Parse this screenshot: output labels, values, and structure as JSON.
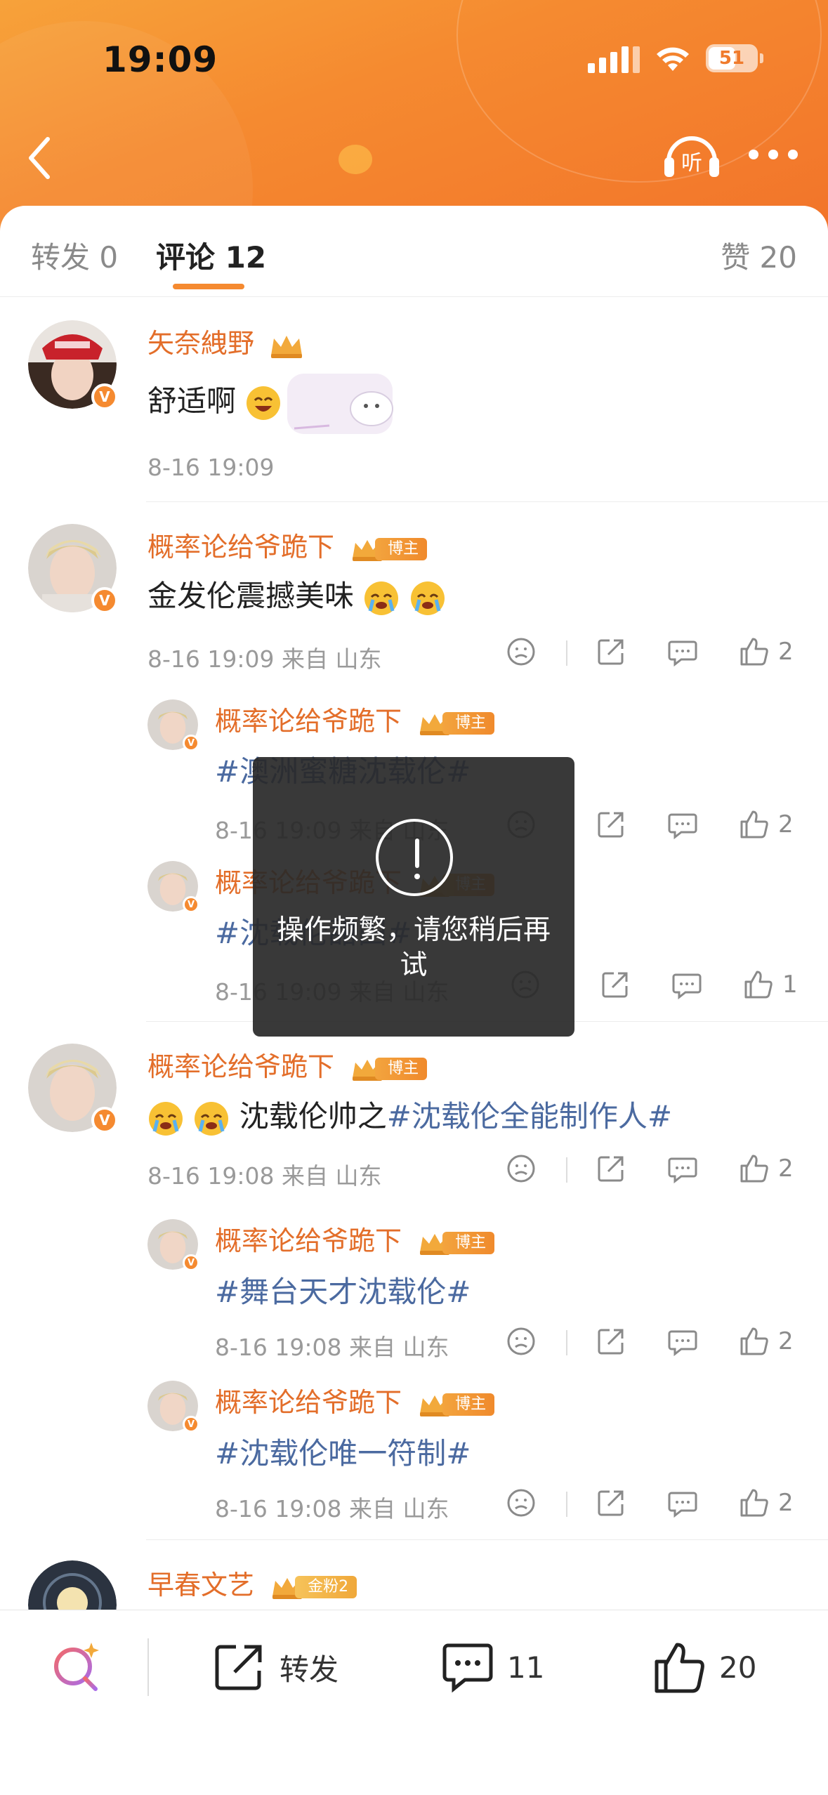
{
  "status_bar": {
    "time": "19:09",
    "battery": "51"
  },
  "header": {
    "listen_label": "听"
  },
  "tabs": {
    "repost": "转发 0",
    "comment": "评论 12",
    "like": "赞 20"
  },
  "comments": [
    {
      "name": "矢奈絏野",
      "text": "舒适啊",
      "time": "8-16 19:09"
    },
    {
      "name": "概率论给爷跪下",
      "badge": "博主",
      "text": "金发伦震撼美味",
      "time": "8-16 19:09 来自 山东",
      "likes": "2",
      "replies": [
        {
          "name": "概率论给爷跪下",
          "badge": "博主",
          "text": "#澳洲蜜糖沈载伦#",
          "time": "8-16 19:09 来自 山东",
          "likes": "2"
        },
        {
          "name": "概率论给爷跪下",
          "badge": "博主",
          "text": "#沈载伦甜田#",
          "time": "8-16 19:09 来自 山东",
          "likes": "1"
        }
      ]
    },
    {
      "name": "概率论给爷跪下",
      "badge": "博主",
      "text_plain": "沈载伦帅之",
      "text_topic": "#沈载伦全能制作人#",
      "time": "8-16 19:08 来自 山东",
      "likes": "2",
      "replies": [
        {
          "name": "概率论给爷跪下",
          "badge": "博主",
          "text": "#舞台天才沈载伦#",
          "time": "8-16 19:08 来自 山东",
          "likes": "2"
        },
        {
          "name": "概率论给爷跪下",
          "badge": "博主",
          "text": "#沈载伦唯一符制#",
          "time": "8-16 19:08 来自 山东",
          "likes": "2"
        }
      ]
    },
    {
      "name": "早春文艺",
      "badge": "金粉2"
    }
  ],
  "toast": {
    "message": "操作频繁，请您稍后再试"
  },
  "bottom_bar": {
    "repost": "转发",
    "comments": "11",
    "likes": "20"
  },
  "colors": {
    "accent": "#f58a30",
    "name": "#e36e2a",
    "topic": "#4b6aa0"
  }
}
